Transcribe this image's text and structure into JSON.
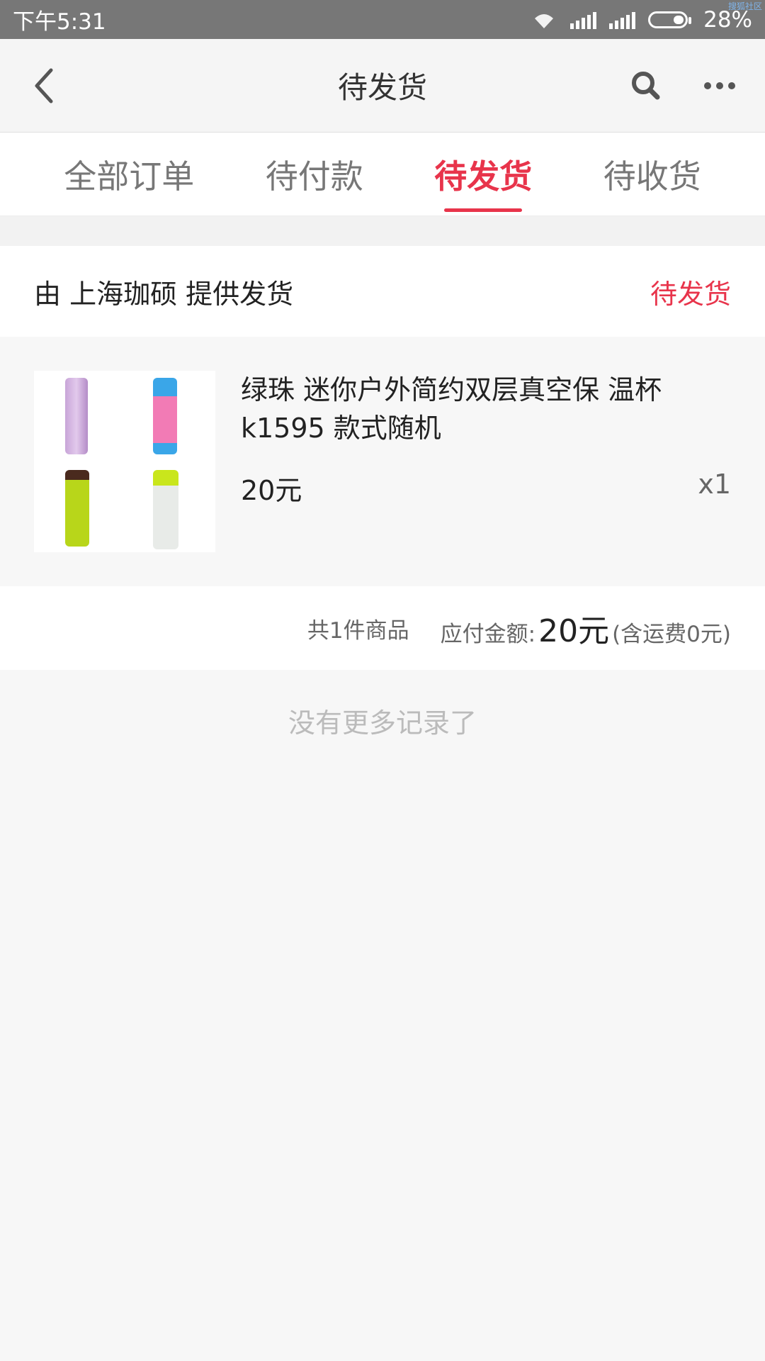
{
  "status_bar": {
    "time": "下午5:31",
    "battery": "28%",
    "watermark": "搜狐社区"
  },
  "header": {
    "title": "待发货",
    "back_icon": "back-icon",
    "search_icon": "search-icon",
    "more_icon": "more-icon"
  },
  "tabs": [
    {
      "label": "全部订单",
      "active": false
    },
    {
      "label": "待付款",
      "active": false
    },
    {
      "label": "待发货",
      "active": true
    },
    {
      "label": "待收货",
      "active": false
    }
  ],
  "order": {
    "shipper": "由 上海珈硕 提供发货",
    "status": "待发货",
    "product": {
      "name": "绿珠 迷你户外简约双层真空保 温杯 k1595 款式随机",
      "price": "20元",
      "quantity": "x1"
    },
    "summary": {
      "count": "共1件商品",
      "pay_label": "应付金额:",
      "pay_amount": "20元",
      "shipping_note": "(含运费0元)"
    }
  },
  "footer_note": "没有更多记录了",
  "colors": {
    "accent": "#e8344b",
    "status_bar": "#777777"
  }
}
